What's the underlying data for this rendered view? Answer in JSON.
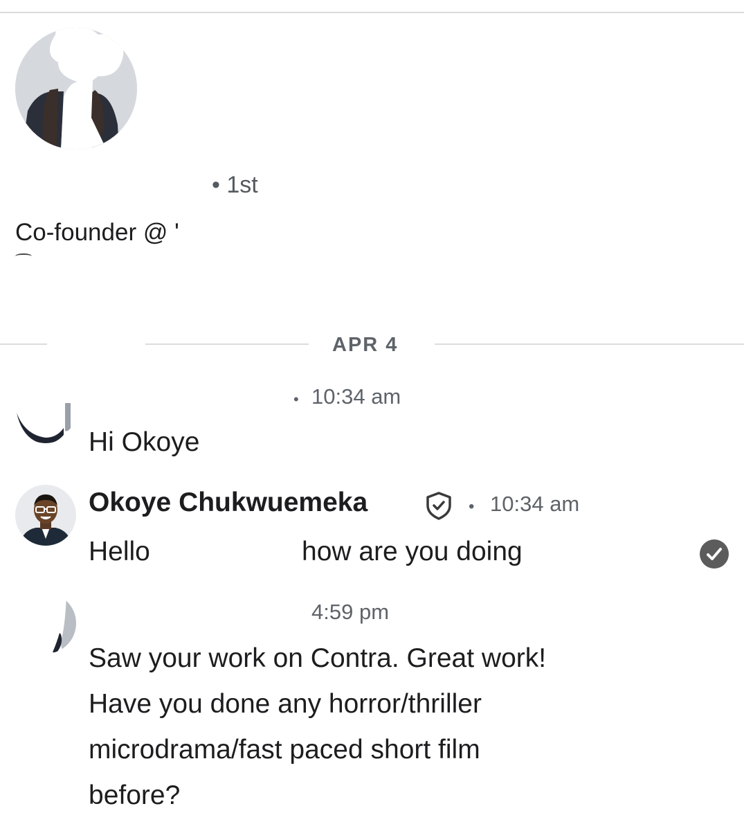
{
  "profile": {
    "connection_degree": "• 1st",
    "headline": "Co-founder @ '"
  },
  "conversation": {
    "date_separator": "APR 4",
    "messages": [
      {
        "time": "10:34 am",
        "text": "Hi Okoye",
        "avatar": "redacted-photo"
      },
      {
        "sender": "Okoye Chukwuemeka",
        "time": "10:34 am",
        "text_part1": "Hello",
        "text_part2": "how are you doing",
        "avatar": "sender-photo",
        "status": "read"
      },
      {
        "time": "4:59 pm",
        "lines": [
          "Saw your work on Contra. Great work!",
          "Have you done any horror/thriller",
          "microdrama/fast paced short film",
          "before?"
        ],
        "avatar": "redacted-photo"
      }
    ]
  },
  "colors": {
    "text": "#1d1d1f",
    "muted": "#5e6369",
    "divider": "#dcdcdc",
    "receipt": "#5c5c5c"
  },
  "icons": [
    "verified-shield-icon",
    "read-receipt-check-icon"
  ]
}
